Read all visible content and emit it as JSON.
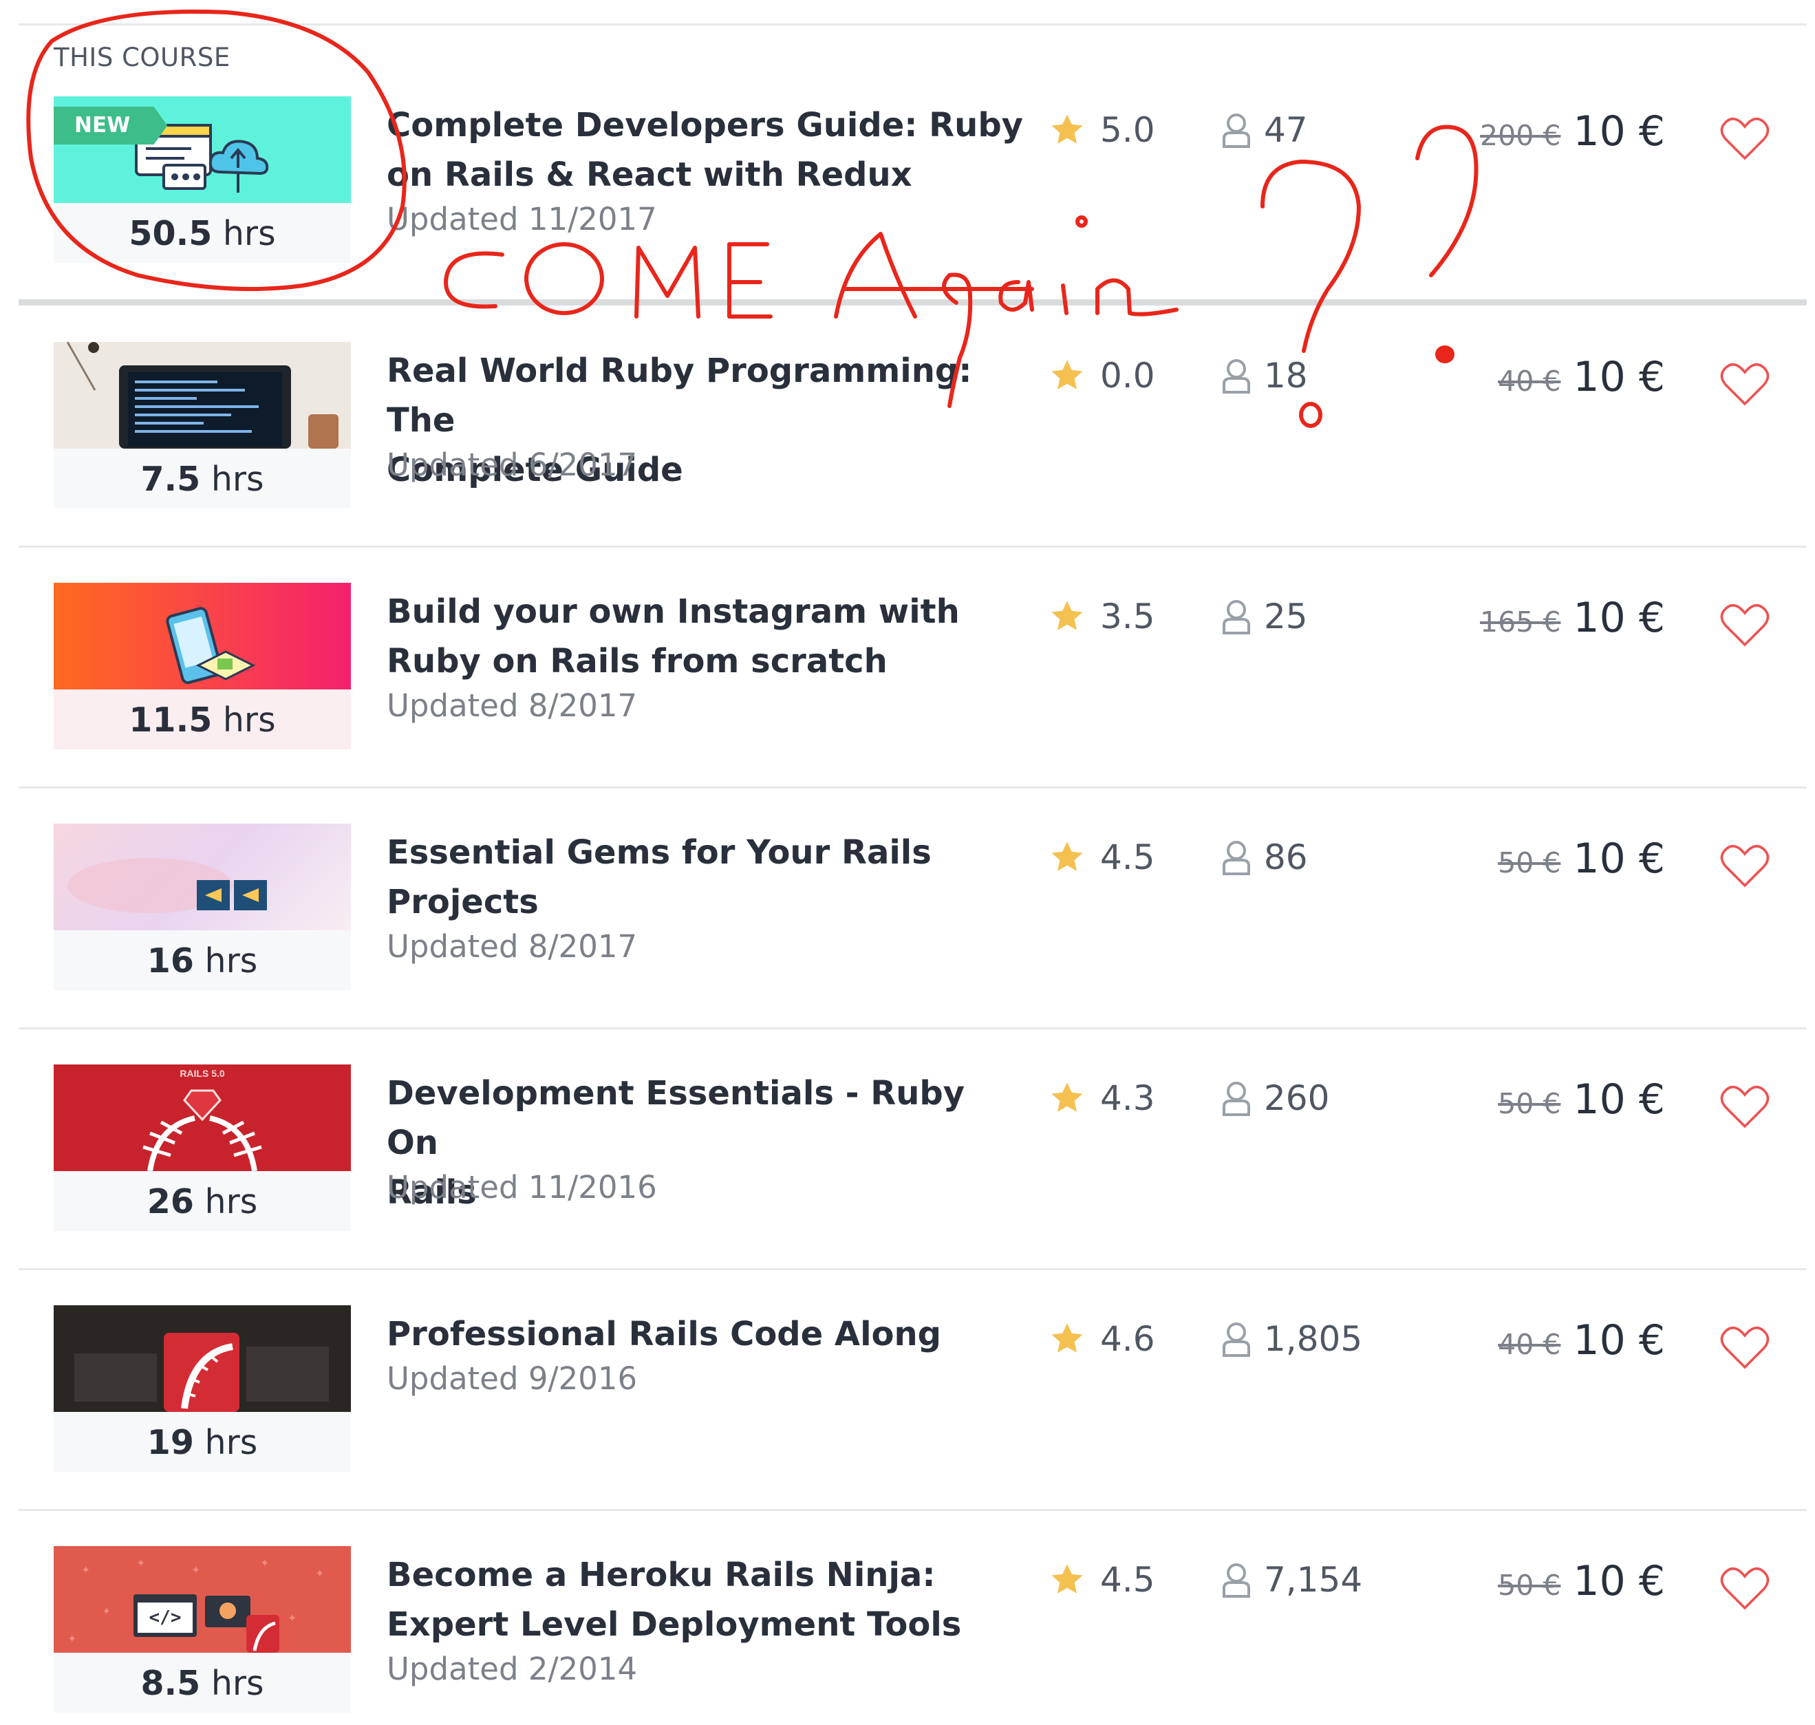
{
  "section_label": "THIS COURSE",
  "courses": [
    {
      "title_line1": "Complete Developers Guide: Ruby",
      "title_line2": "on Rails & React with Redux",
      "updated": "Updated 11/2017",
      "rating": "5.0",
      "students": "47",
      "old_price": "200 €",
      "price": "10 €",
      "hours_num": "50.5",
      "hours_unit": "hrs",
      "badge": "NEW"
    },
    {
      "title_line1": "Real World Ruby Programming: The",
      "title_line2": "Complete Guide",
      "updated": "Updated 6/2017",
      "rating": "0.0",
      "students": "18",
      "old_price": "40 €",
      "price": "10 €",
      "hours_num": "7.5",
      "hours_unit": "hrs"
    },
    {
      "title_line1": "Build your own Instagram with",
      "title_line2": "Ruby on Rails from scratch",
      "updated": "Updated 8/2017",
      "rating": "3.5",
      "students": "25",
      "old_price": "165 €",
      "price": "10 €",
      "hours_num": "11.5",
      "hours_unit": "hrs"
    },
    {
      "title_line1": "Essential Gems for Your Rails",
      "title_line2": "Projects",
      "updated": "Updated 8/2017",
      "rating": "4.5",
      "students": "86",
      "old_price": "50 €",
      "price": "10 €",
      "hours_num": "16",
      "hours_unit": "hrs"
    },
    {
      "title_line1": "Development Essentials - Ruby On",
      "title_line2": "Rails",
      "updated": "Updated 11/2016",
      "rating": "4.3",
      "students": "260",
      "old_price": "50 €",
      "price": "10 €",
      "hours_num": "26",
      "hours_unit": "hrs",
      "thumb_text": "RAILS 5.0"
    },
    {
      "title_line1": "Professional Rails Code Along",
      "title_line2": "",
      "updated": "Updated 9/2016",
      "rating": "4.6",
      "students": "1,805",
      "old_price": "40 €",
      "price": "10 €",
      "hours_num": "19",
      "hours_unit": "hrs"
    },
    {
      "title_line1": "Become a Heroku Rails Ninja:",
      "title_line2": "Expert Level Deployment Tools",
      "updated": "Updated 2/2014",
      "rating": "4.5",
      "students": "7,154",
      "old_price": "50 €",
      "price": "10 €",
      "hours_num": "8.5",
      "hours_unit": "hrs",
      "thumb_text": "</>"
    }
  ],
  "annotation": {
    "text": "COME Again ??",
    "color": "#e8261b"
  },
  "colors": {
    "star": "#f4c150",
    "heart": "#ec5252",
    "new_badge": "#3dbd89"
  },
  "icons": [
    "star-icon",
    "user-icon",
    "heart-icon"
  ]
}
